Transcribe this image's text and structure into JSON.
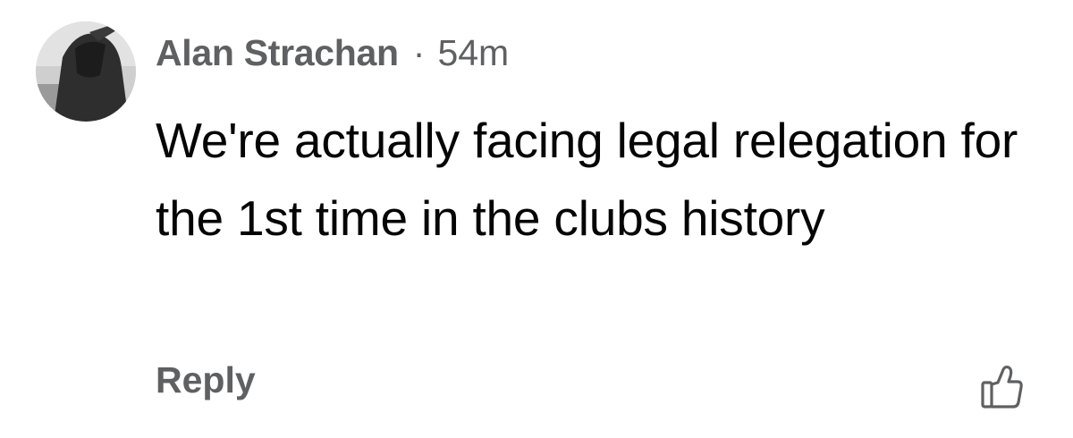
{
  "comment": {
    "author": "Alan Strachan",
    "separator": "·",
    "timestamp": "54m",
    "text": "We're actually facing legal relegation for the 1st time in the clubs history",
    "reply_label": "Reply",
    "like_icon": "thumbs-up-icon"
  },
  "colors": {
    "meta_text": "#5f6062",
    "body_text": "#050505",
    "background": "#ffffff"
  }
}
